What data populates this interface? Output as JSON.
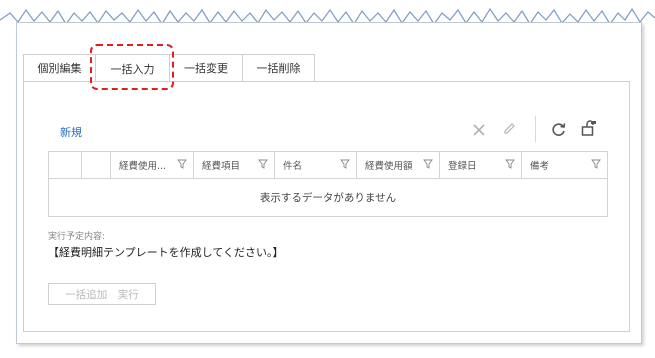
{
  "tabs": [
    {
      "label": "個別編集"
    },
    {
      "label": "一括入力"
    },
    {
      "label": "一括変更"
    },
    {
      "label": "一括削除"
    }
  ],
  "toolbar": {
    "new_label": "新規",
    "icons": [
      "close-icon",
      "edit-icon",
      "refresh-icon",
      "lock-open-icon"
    ]
  },
  "grid": {
    "columns": [
      "経費使用...",
      "経費項目",
      "件名",
      "経費使用額",
      "登録日",
      "備考"
    ],
    "empty_message": "表示するデータがありません"
  },
  "plan": {
    "label": "実行予定内容:",
    "text": "【経費明細テンプレートを作成してください。】"
  },
  "exec_button": "一括追加　実行",
  "colors": {
    "accent": "#2a6fc2",
    "highlight": "#e02020"
  }
}
